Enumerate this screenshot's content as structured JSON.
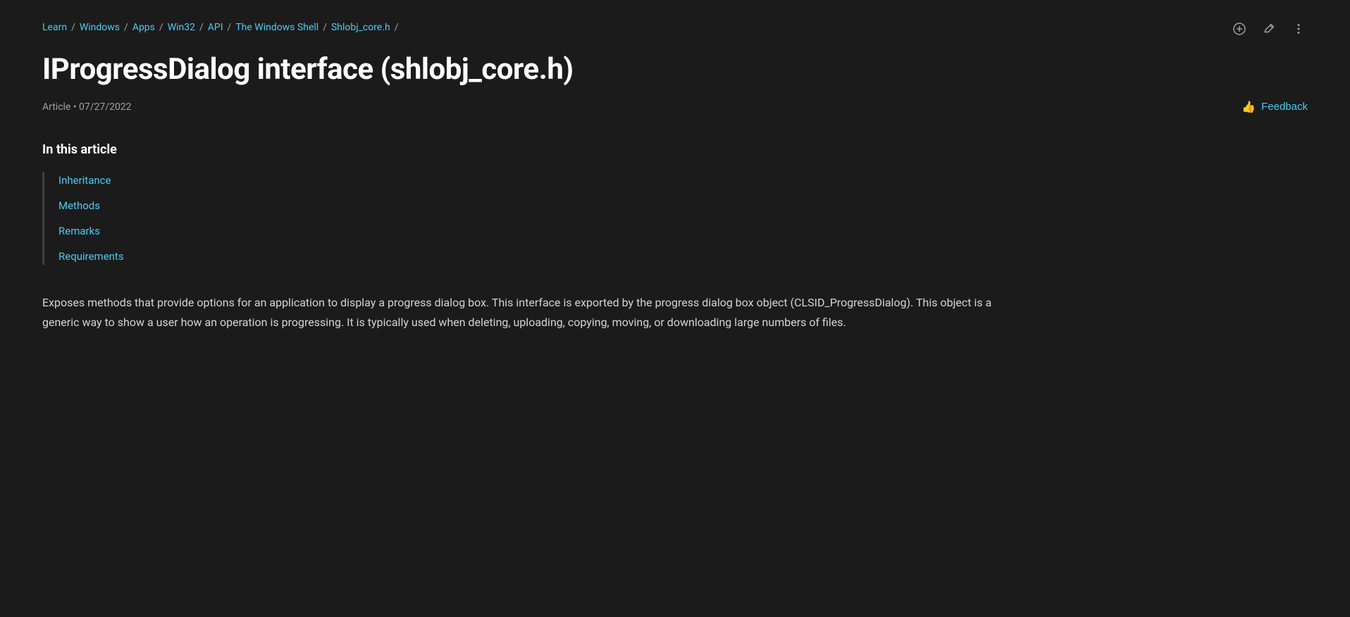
{
  "breadcrumb": {
    "items": [
      {
        "label": "Learn",
        "href": "#",
        "type": "link"
      },
      {
        "label": "Windows",
        "href": "#",
        "type": "link"
      },
      {
        "label": "Apps",
        "href": "#",
        "type": "link"
      },
      {
        "label": "Win32",
        "href": "#",
        "type": "link"
      },
      {
        "label": "API",
        "href": "#",
        "type": "link"
      },
      {
        "label": "The Windows Shell",
        "href": "#",
        "type": "link-highlight"
      },
      {
        "label": "Shlobj_core.h",
        "href": "#",
        "type": "link-highlight"
      }
    ],
    "separator": "/"
  },
  "icons": {
    "add_label": "+",
    "edit_label": "✎",
    "more_label": "⋮",
    "feedback_label": "👍"
  },
  "page": {
    "title": "IProgressDialog interface (shlobj_core.h)",
    "article_label": "Article",
    "date": "07/27/2022",
    "feedback_label": "Feedback"
  },
  "toc": {
    "heading": "In this article",
    "items": [
      {
        "label": "Inheritance",
        "href": "#inheritance"
      },
      {
        "label": "Methods",
        "href": "#methods"
      },
      {
        "label": "Remarks",
        "href": "#remarks"
      },
      {
        "label": "Requirements",
        "href": "#requirements"
      }
    ]
  },
  "description": "Exposes methods that provide options for an application to display a progress dialog box. This interface is exported by the progress dialog box object (CLSID_ProgressDialog). This object is a generic way to show a user how an operation is progressing. It is typically used when deleting, uploading, copying, moving, or downloading large numbers of files."
}
